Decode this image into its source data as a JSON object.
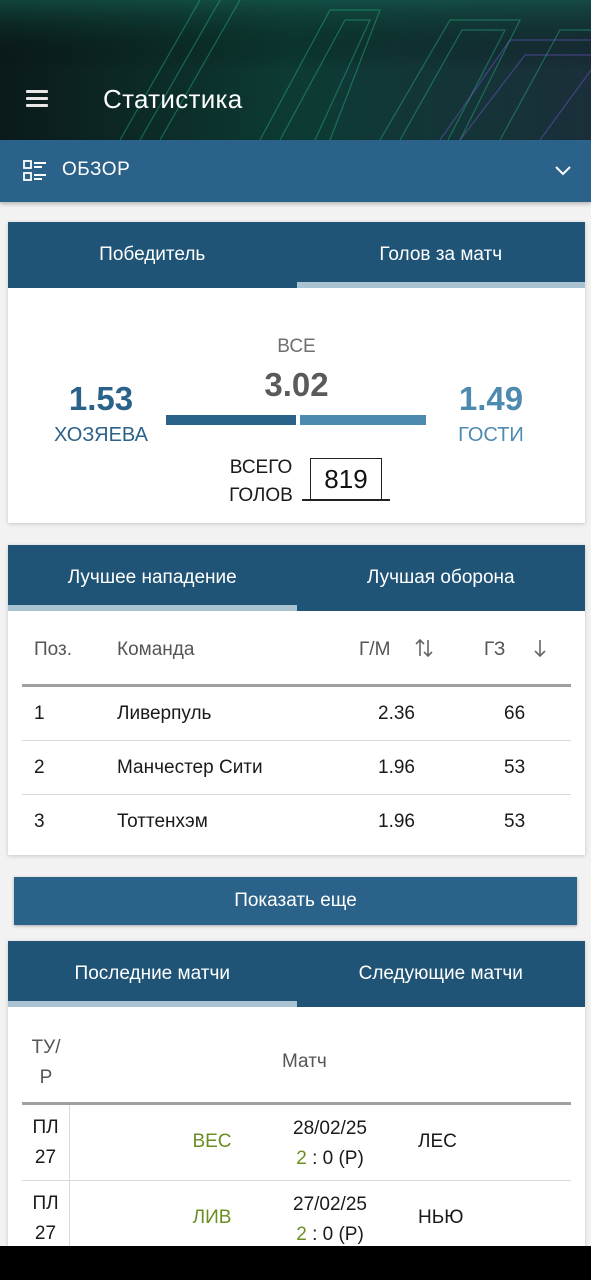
{
  "header": {
    "title": "Статистика"
  },
  "selector": {
    "label": "ОБЗОР"
  },
  "goals_card": {
    "tabs": [
      "Победитель",
      "Голов за матч"
    ],
    "all_label": "ВСЕ",
    "all_value": "3.02",
    "home_value": "1.53",
    "home_label": "ХОЗЯЕВА",
    "away_value": "1.49",
    "away_label": "ГОСТИ",
    "total_label_1": "ВСЕГО",
    "total_label_2": "ГОЛОВ",
    "total_value": "819",
    "home_avg": 1.53,
    "away_avg": 1.49
  },
  "teams_card": {
    "tabs": [
      "Лучшее нападение",
      "Лучшая оборона"
    ],
    "columns": {
      "pos": "Поз.",
      "team": "Команда",
      "gpm": "Г/М",
      "gs": "ГЗ"
    },
    "rows": [
      {
        "pos": "1",
        "team": "Ливерпуль",
        "gpm": "2.36",
        "gs": "66"
      },
      {
        "pos": "2",
        "team": "Манчестер Сити",
        "gpm": "1.96",
        "gs": "53"
      },
      {
        "pos": "3",
        "team": "Тоттенхэм",
        "gpm": "1.96",
        "gs": "53"
      }
    ]
  },
  "show_more": "Показать еще",
  "matches_card": {
    "tabs": [
      "Последние матчи",
      "Следующие матчи"
    ],
    "col_round_1": "ТУ/",
    "col_round_2": "Р",
    "col_match": "Матч",
    "rows": [
      {
        "round_1": "ПЛ",
        "round_2": "27",
        "home": "ВЕС",
        "date": "28/02/25",
        "home_score": "2",
        "rest_score": ": 0 (Р)",
        "away": "ЛЕС"
      },
      {
        "round_1": "ПЛ",
        "round_2": "27",
        "home": "ЛИВ",
        "date": "27/02/25",
        "home_score": "2",
        "rest_score": ": 0 (Р)",
        "away": "НЬЮ"
      }
    ]
  },
  "colors": {
    "primary": "#2b6289",
    "tab_bg": "#1f5476",
    "accent_green": "#6b8e23",
    "away_blue": "#4d8ab0"
  }
}
